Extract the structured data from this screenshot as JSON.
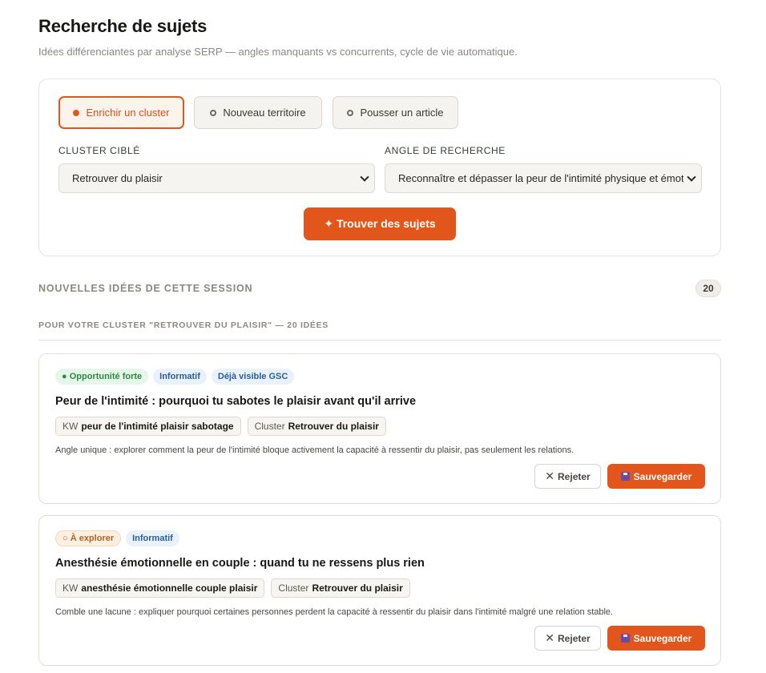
{
  "header": {
    "title": "Recherche de sujets",
    "subtitle": "Idées différenciantes par analyse SERP — angles manquants vs concurrents, cycle de vie automatique."
  },
  "modes": [
    {
      "label": "Enrichir un cluster",
      "active": true
    },
    {
      "label": "Nouveau territoire",
      "active": false
    },
    {
      "label": "Pousser un article",
      "active": false
    }
  ],
  "form": {
    "cluster_label": "CLUSTER CIBLÉ",
    "cluster_value": "Retrouver du plaisir",
    "angle_label": "ANGLE DE RECHERCHE",
    "angle_value": "Reconnaître et dépasser la peur de l'intimité physique et émotionnelle",
    "submit_label": "✦ Trouver des sujets"
  },
  "results": {
    "section_title": "NOUVELLES IDÉES DE CETTE SESSION",
    "count": "20",
    "subsection_title": "POUR VOTRE CLUSTER \"RETROUVER DU PLAISIR\" — 20 IDÉES"
  },
  "ideas": [
    {
      "tags": [
        {
          "label": "● Opportunité forte",
          "style": "green"
        },
        {
          "label": "Informatif",
          "style": "blue"
        },
        {
          "label": "Déjà visible GSC",
          "style": "blue"
        }
      ],
      "title": "Peur de l'intimité : pourquoi tu sabotes le plaisir avant qu'il arrive",
      "kw_prefix": "KW",
      "kw": "peur de l'intimité plaisir sabotage",
      "cluster_prefix": "Cluster",
      "cluster": "Retrouver du plaisir",
      "description": "Angle unique : explorer comment la peur de l'intimité bloque activement la capacité à ressentir du plaisir, pas seulement les relations.",
      "reject_label": "Rejeter",
      "save_label": "Sauvegarder"
    },
    {
      "tags": [
        {
          "label": "○ À explorer",
          "style": "orange"
        },
        {
          "label": "Informatif",
          "style": "blue"
        }
      ],
      "title": "Anesthésie émotionnelle en couple : quand tu ne ressens plus rien",
      "kw_prefix": "KW",
      "kw": "anesthésie émotionnelle couple plaisir",
      "cluster_prefix": "Cluster",
      "cluster": "Retrouver du plaisir",
      "description": "Comble une lacune : expliquer pourquoi certaines personnes perdent la capacité à ressentir du plaisir dans l'intimité malgré une relation stable.",
      "reject_label": "Rejeter",
      "save_label": "Sauvegarder"
    }
  ],
  "colors": {
    "accent": "#e2561b",
    "success": "#2f8a41",
    "info": "#2a5d96"
  }
}
